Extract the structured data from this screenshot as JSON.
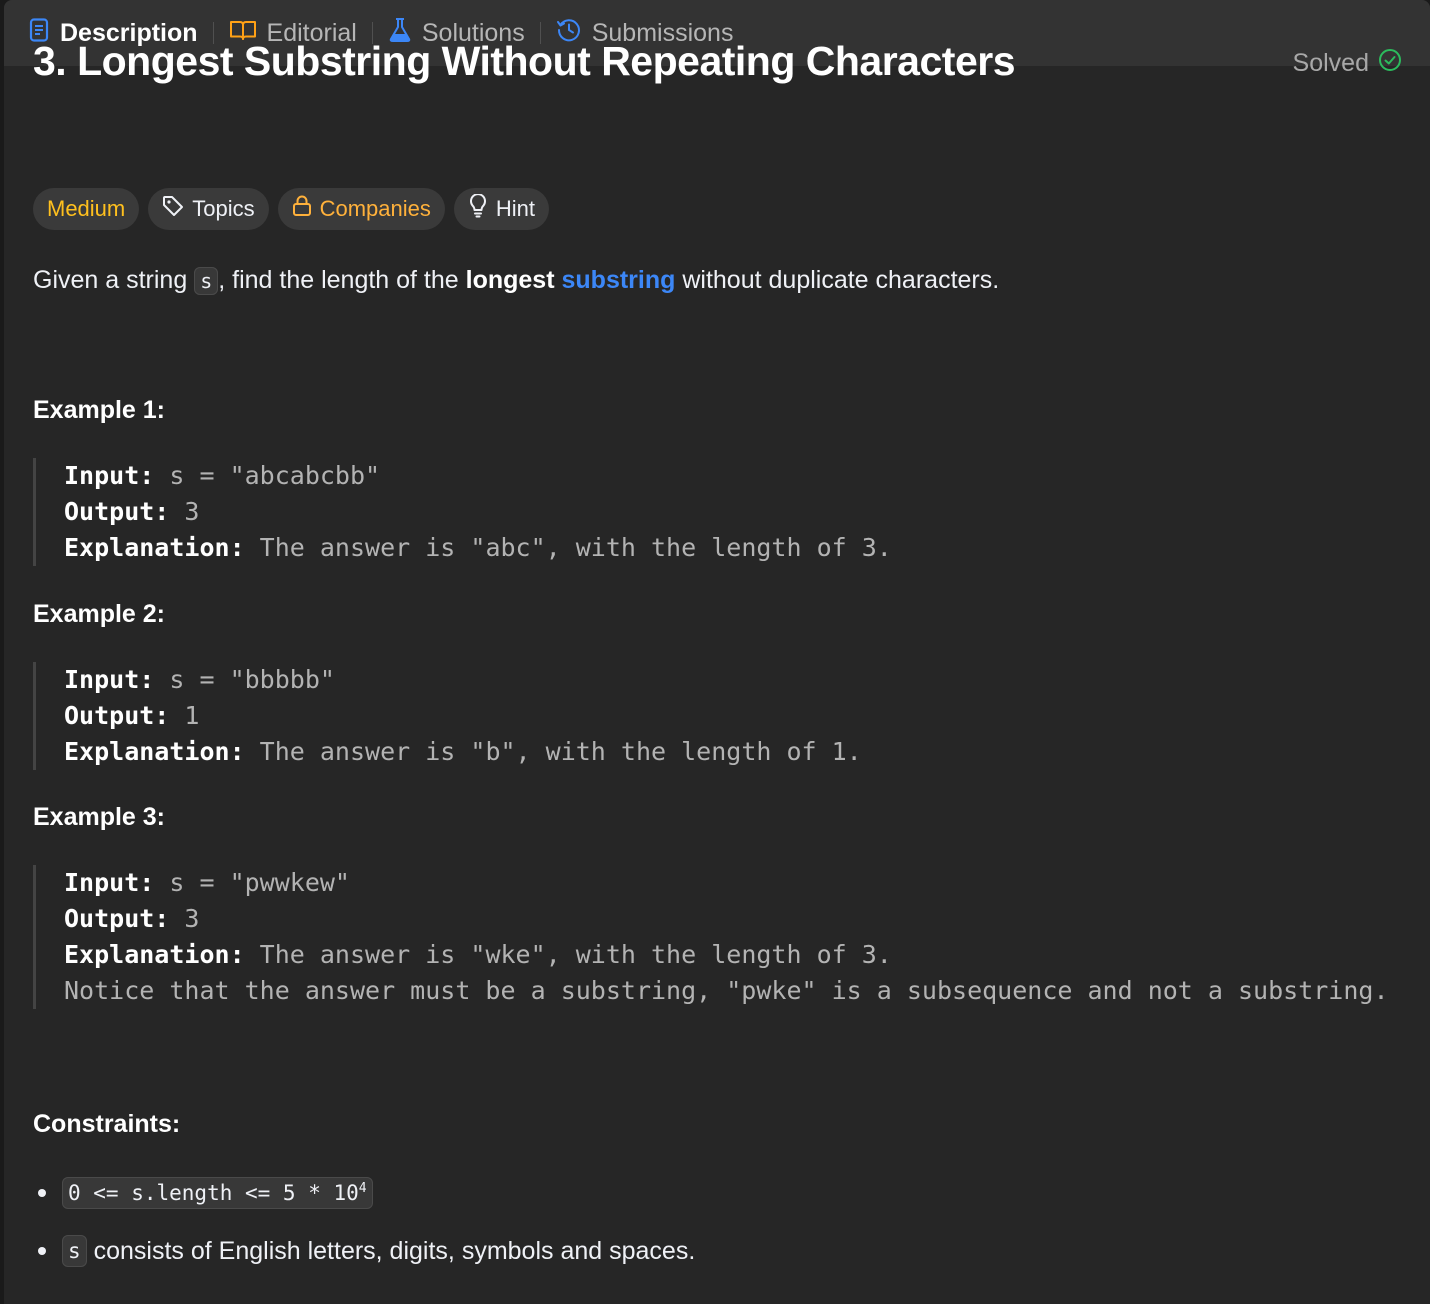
{
  "tabs": [
    {
      "label": "Description",
      "icon": "description-doc-icon",
      "active": true
    },
    {
      "label": "Editorial",
      "icon": "book-open-icon",
      "active": false
    },
    {
      "label": "Solutions",
      "icon": "flask-icon",
      "active": false
    },
    {
      "label": "Submissions",
      "icon": "history-clock-icon",
      "active": false
    }
  ],
  "problem": {
    "title": "3. Longest Substring Without Repeating Characters",
    "status": "Solved",
    "status_icon": "check-circle-icon"
  },
  "tags": {
    "difficulty": "Medium",
    "topics": "Topics",
    "companies": "Companies",
    "hint": "Hint"
  },
  "description": {
    "part1": "Given a string ",
    "code_s": "s",
    "part2": ", find the length of the ",
    "bold": "longest",
    "space": " ",
    "link": "substring",
    "part3": " without duplicate characters."
  },
  "examples": [
    {
      "title": "Example 1:",
      "input_label": "Input:",
      "input": " s = \"abcabcbb\"",
      "output_label": "Output:",
      "output": " 3",
      "explanation_label": "Explanation:",
      "explanation": " The answer is \"abc\", with the length of 3.",
      "note": ""
    },
    {
      "title": "Example 2:",
      "input_label": "Input:",
      "input": " s = \"bbbbb\"",
      "output_label": "Output:",
      "output": " 1",
      "explanation_label": "Explanation:",
      "explanation": " The answer is \"b\", with the length of 1.",
      "note": ""
    },
    {
      "title": "Example 3:",
      "input_label": "Input:",
      "input": " s = \"pwwkew\"",
      "output_label": "Output:",
      "output": " 3",
      "explanation_label": "Explanation:",
      "explanation": " The answer is \"wke\", with the length of 3.",
      "note": "Notice that the answer must be a substring, \"pwke\" is a subsequence and not a substring."
    }
  ],
  "constraints": {
    "title": "Constraints:",
    "c1_code": "0 <= s.length <= 5 * 10",
    "c1_sup": "4",
    "c2_code": "s",
    "c2_text": " consists of English letters, digits, symbols and spaces."
  },
  "colors": {
    "medium": "#ffc01e",
    "companies": "#ffb13b",
    "link": "#3c87f7",
    "solved_check": "#2cbb5d",
    "description_icon": "#3c87f7"
  }
}
